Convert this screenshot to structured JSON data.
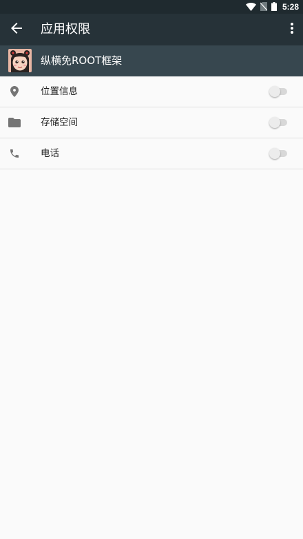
{
  "status_bar": {
    "time": "5:28",
    "icons": [
      "wifi-icon",
      "no-sim-icon",
      "battery-icon"
    ]
  },
  "app_bar": {
    "title": "应用权限",
    "back_icon": "arrow-back-icon",
    "overflow_icon": "more-vert-icon",
    "background": "#263238"
  },
  "app_header": {
    "app_name": "纵横免ROOT框架",
    "background": "#37474f"
  },
  "permissions": [
    {
      "label": "位置信息",
      "icon": "location-pin-icon",
      "enabled": false
    },
    {
      "label": "存储空间",
      "icon": "folder-icon",
      "enabled": false
    },
    {
      "label": "电话",
      "icon": "phone-icon",
      "enabled": false
    }
  ]
}
